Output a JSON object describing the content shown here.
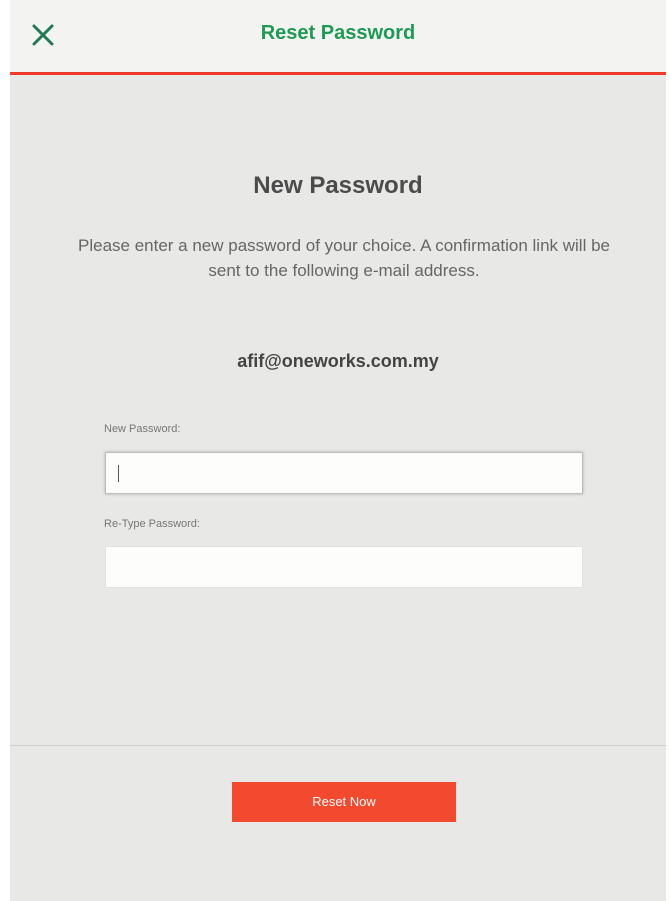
{
  "header": {
    "title": "Reset Password",
    "close_icon": "close-icon"
  },
  "content": {
    "title": "New Password",
    "instructions": "Please enter a new password of your choice. A confirmation link will be sent to the following e-mail address.",
    "email": "afif@oneworks.com.my"
  },
  "form": {
    "new_password": {
      "label": "New Password:",
      "value": ""
    },
    "retype_password": {
      "label": "Re-Type Password:",
      "value": ""
    }
  },
  "actions": {
    "reset_label": "Reset Now"
  },
  "colors": {
    "header_title": "#1d9a53",
    "close_icon": "#1f7a55",
    "header_border": "#ee3b2b",
    "button_bg": "#f2492f"
  }
}
